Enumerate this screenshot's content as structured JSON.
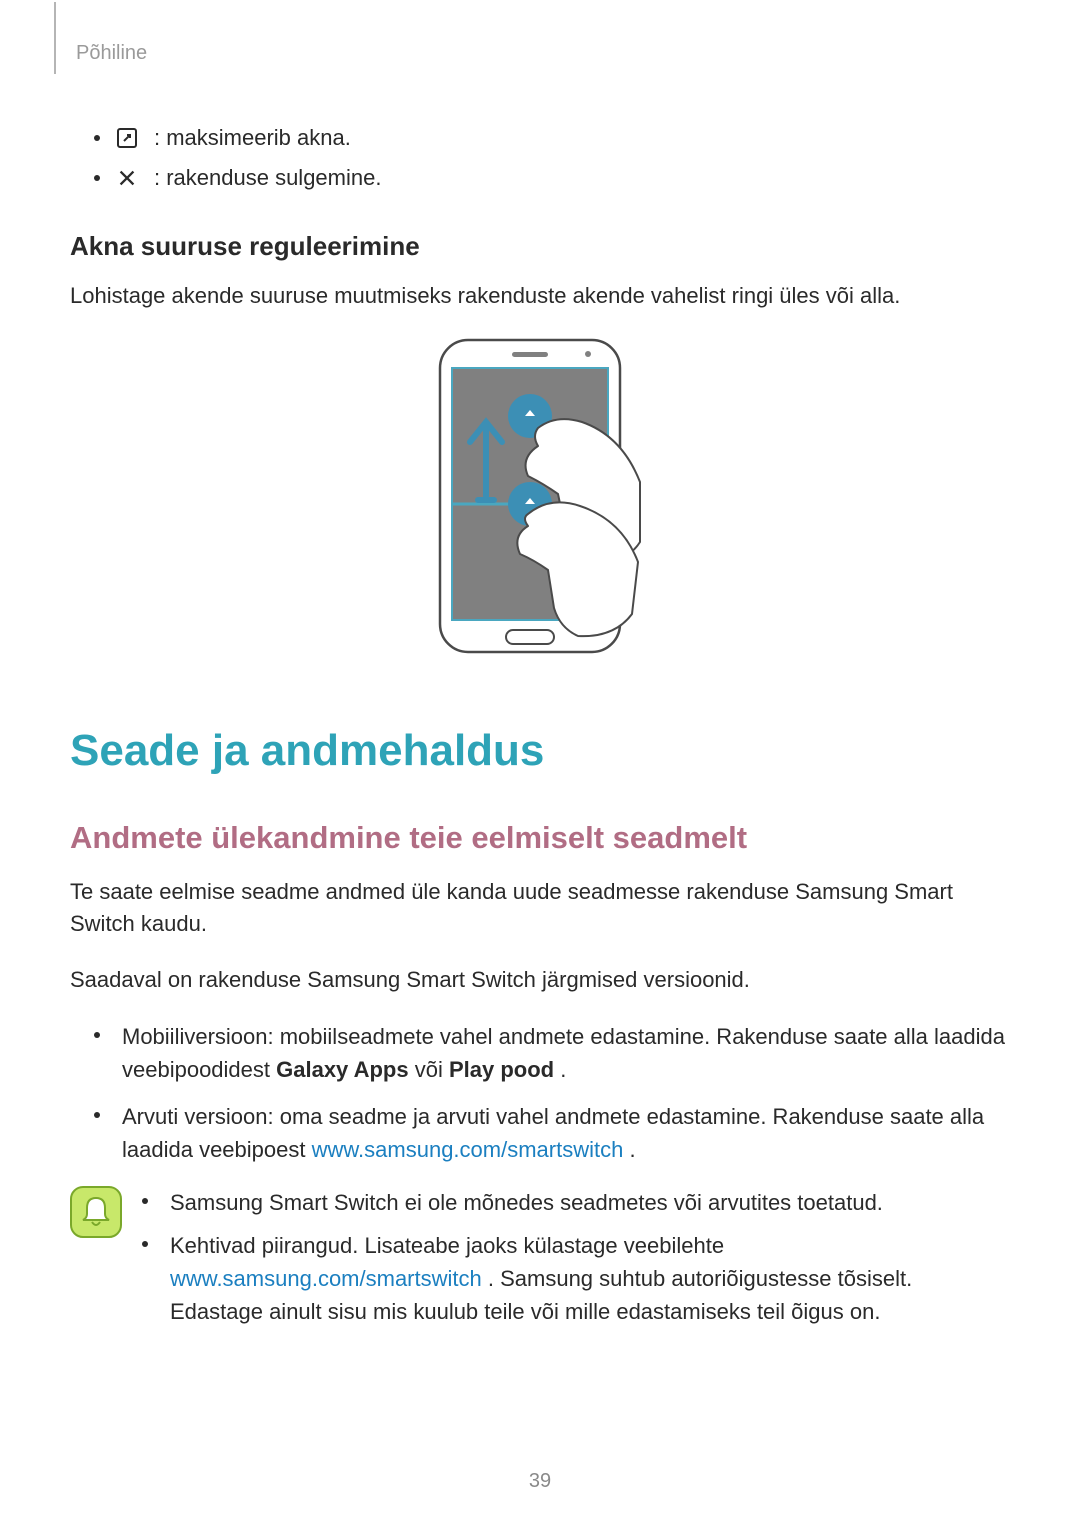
{
  "running_head": "Põhiline",
  "icon_bullets": [
    {
      "id": "maximize-icon",
      "text": ": maksimeerib akna."
    },
    {
      "id": "close-icon",
      "text": ": rakenduse sulgemine."
    }
  ],
  "section1": {
    "heading": "Akna suuruse reguleerimine",
    "body": "Lohistage akende suuruse muutmiseks rakenduste akende vahelist ringi üles või alla."
  },
  "h1": "Seade ja andmehaldus",
  "section2": {
    "heading": "Andmete ülekandmine teie eelmiselt seadmelt",
    "p1": "Te saate eelmise seadme andmed üle kanda uude seadmesse rakenduse Samsung Smart Switch kaudu.",
    "p2": "Saadaval on rakenduse Samsung Smart Switch järgmised versioonid.",
    "bullets": {
      "b1_pre": "Mobiiliversioon: mobiilseadmete vahel andmete edastamine. Rakenduse saate alla laadida veebipoodidest ",
      "b1_bold1": "Galaxy Apps",
      "b1_mid": " või ",
      "b1_bold2": "Play pood",
      "b1_post": ".",
      "b2_pre": "Arvuti versioon: oma seadme ja arvuti vahel andmete edastamine. Rakenduse saate alla laadida veebipoest ",
      "b2_link": "www.samsung.com/smartswitch",
      "b2_post": "."
    },
    "note": {
      "n1": "Samsung Smart Switch ei ole mõnedes seadmetes või arvutites toetatud.",
      "n2_pre": "Kehtivad piirangud. Lisateabe jaoks külastage veebilehte ",
      "n2_link": "www.samsung.com/smartswitch",
      "n2_post": " . Samsung suhtub autoriõigustesse tõsiselt. Edastage ainult sisu mis kuulub teile või mille edastamiseks teil õigus on."
    }
  },
  "page_number": "39"
}
